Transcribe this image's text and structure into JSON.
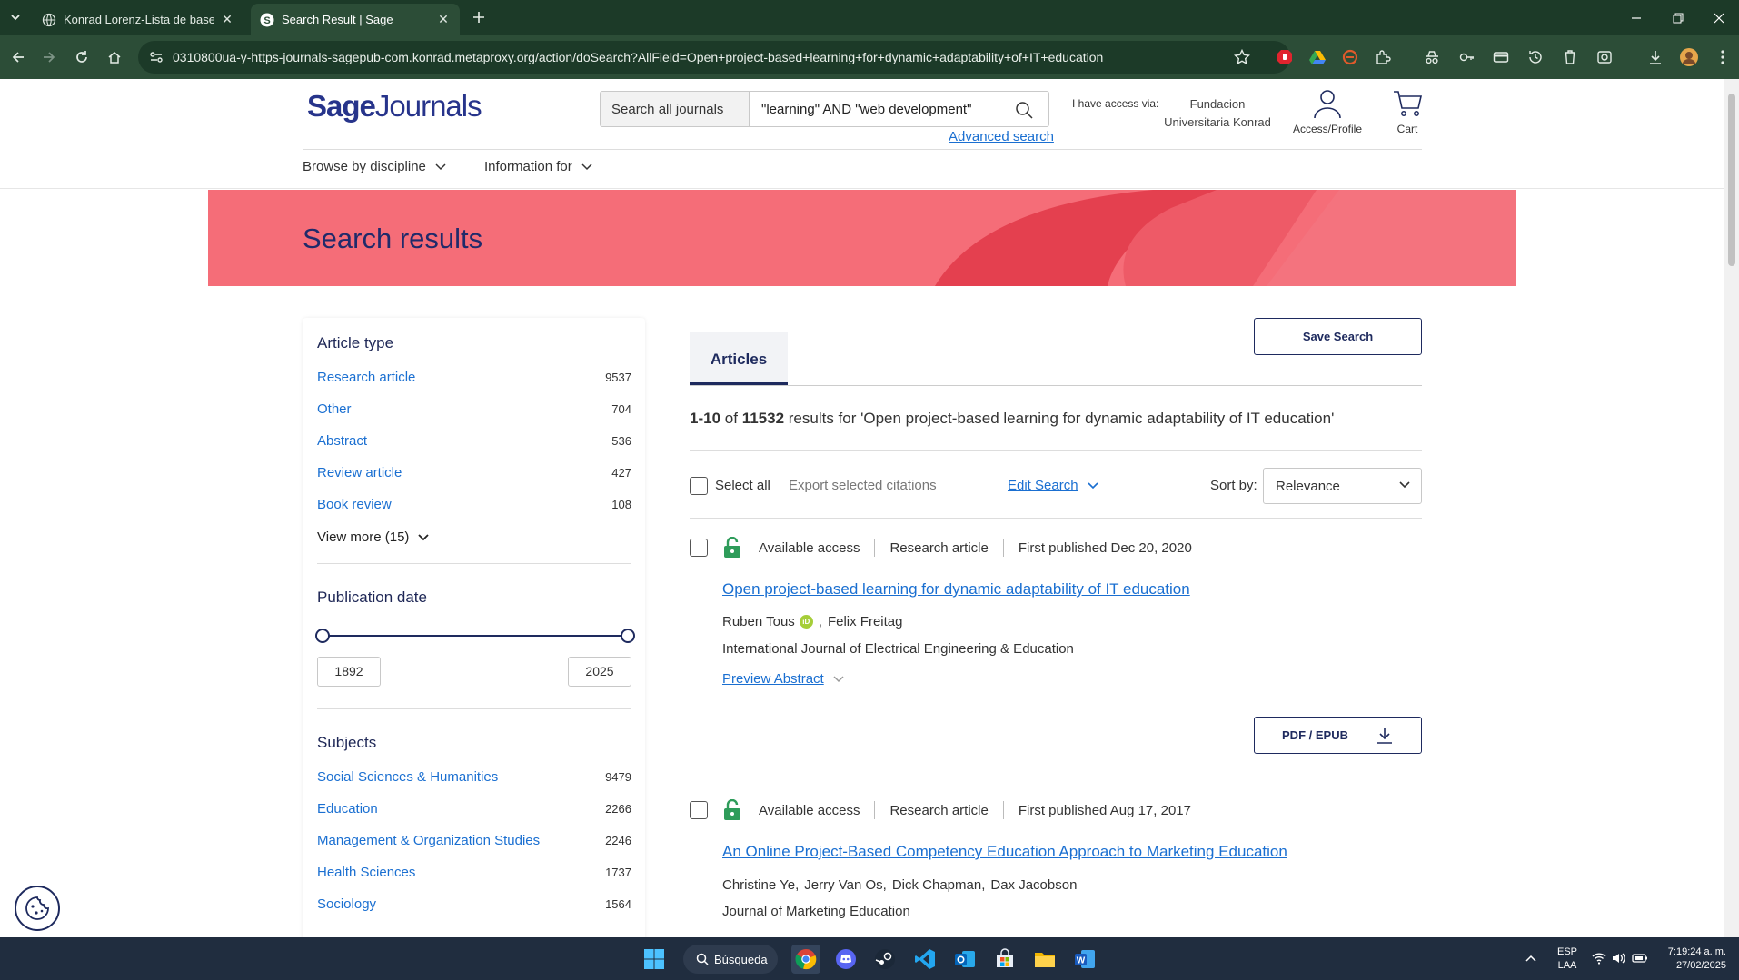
{
  "browser": {
    "tabs": [
      {
        "title": "Konrad Lorenz-Lista de bases: S",
        "active": false
      },
      {
        "title": "Search Result | Sage",
        "active": true
      }
    ],
    "url": "0310800ua-y-https-journals-sagepub-com.konrad.metaproxy.org/action/doSearch?AllField=Open+project-based+learning+for+dynamic+adaptability+of+IT+education"
  },
  "header": {
    "logo_bold": "Sage",
    "logo_light": "Journals",
    "search_scope": "Search all journals",
    "search_query": "\"learning\"  AND \"web development\"",
    "advanced_search": "Advanced search",
    "access_label": "I have access via:",
    "institution": "Fundacion Universitaria Konrad",
    "access_profile": "Access/Profile",
    "cart": "Cart",
    "nav": [
      "Browse by discipline",
      "Information for"
    ]
  },
  "banner": {
    "title": "Search results"
  },
  "sidebar": {
    "article_type": {
      "heading": "Article type",
      "items": [
        {
          "label": "Research article",
          "count": "9537"
        },
        {
          "label": "Other",
          "count": "704"
        },
        {
          "label": "Abstract",
          "count": "536"
        },
        {
          "label": "Review article",
          "count": "427"
        },
        {
          "label": "Book review",
          "count": "108"
        }
      ],
      "view_more": "View more (15)"
    },
    "publication_date": {
      "heading": "Publication date",
      "from": "1892",
      "to": "2025"
    },
    "subjects": {
      "heading": "Subjects",
      "items": [
        {
          "label": "Social Sciences & Humanities",
          "count": "9479"
        },
        {
          "label": "Education",
          "count": "2266"
        },
        {
          "label": "Management & Organization Studies",
          "count": "2246"
        },
        {
          "label": "Health Sciences",
          "count": "1737"
        },
        {
          "label": "Sociology",
          "count": "1564"
        }
      ]
    }
  },
  "main": {
    "tab": "Articles",
    "save_search": "Save Search",
    "summary": {
      "range": "1-10",
      "of": "of",
      "total": "11532",
      "rest": "results for 'Open project-based learning for dynamic adaptability of IT education'"
    },
    "select_all": "Select all",
    "export": "Export selected citations",
    "edit_search": "Edit Search",
    "sort_label": "Sort by:",
    "sort_value": "Relevance",
    "results": [
      {
        "access": "Available access",
        "type": "Research article",
        "published": "First published Dec 20, 2020",
        "title": "Open project-based learning for dynamic adaptability of IT education",
        "authors": [
          "Ruben Tous",
          "Felix Freitag"
        ],
        "journal": "International Journal of Electrical Engineering & Education",
        "preview": "Preview Abstract",
        "pdf": "PDF / EPUB"
      },
      {
        "access": "Available access",
        "type": "Research article",
        "published": "First published Aug 17, 2017",
        "title": "An Online Project-Based Competency Education Approach to Marketing Education",
        "authors": [
          "Christine Ye",
          "Jerry Van Os",
          "Dick Chapman",
          "Dax Jacobson"
        ],
        "journal": "Journal of Marketing Education"
      }
    ]
  },
  "taskbar": {
    "search": "Búsqueda",
    "lang1": "ESP",
    "lang2": "LAA",
    "time": "7:19:24 a. m.",
    "date": "27/02/2025"
  },
  "colors": {
    "brand": "#27348b",
    "banner": "#f56d78",
    "link": "#1a6fd1",
    "access_green": "#2e9c5a"
  }
}
